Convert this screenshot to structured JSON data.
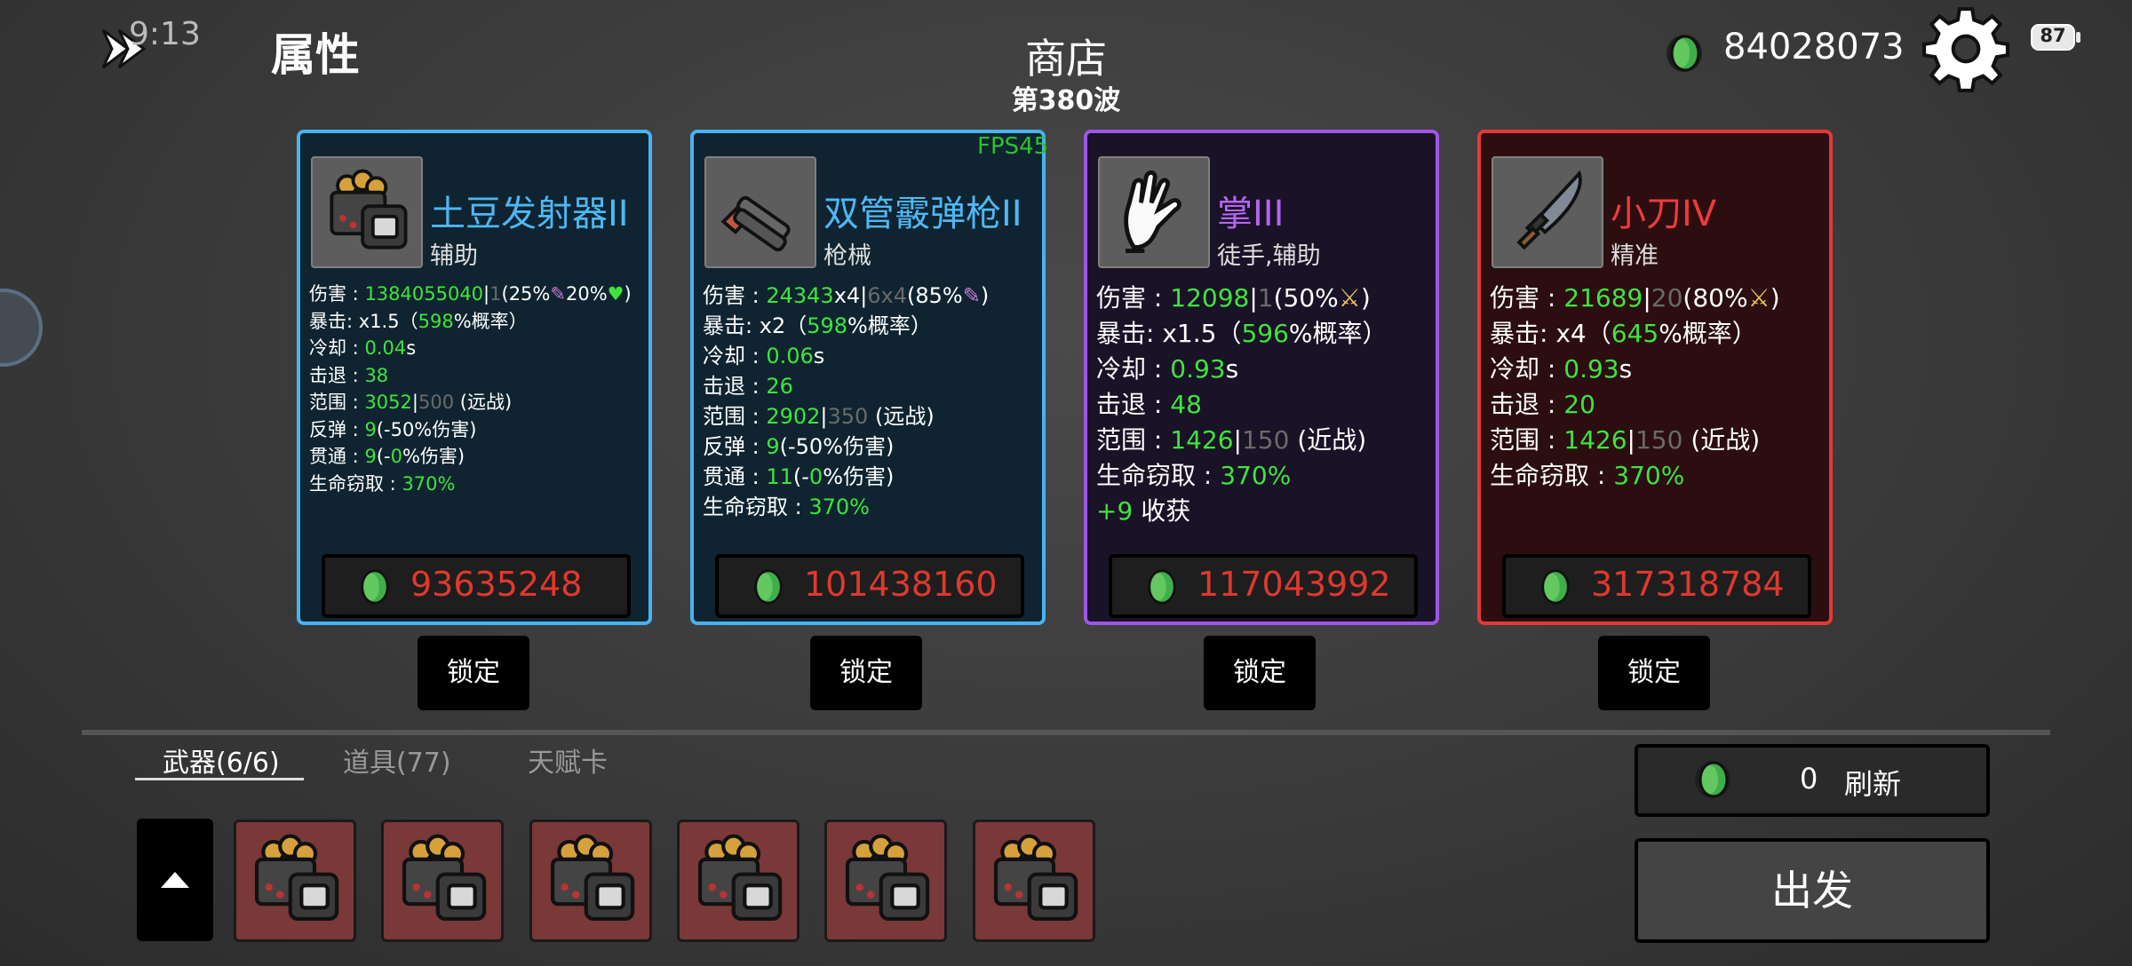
{
  "header": {
    "time": "9:13",
    "attributes_title": "属性",
    "shop_title": "商店",
    "wave": "第380波",
    "money": "84028073",
    "battery": "87",
    "fps": "FPS45"
  },
  "cards": [
    {
      "name": "土豆发射器II",
      "name_color": "#4db8f5",
      "type": "辅助",
      "rarity_color": "#46b4f0",
      "icon": "potato-launcher-icon",
      "damage": "1384055040",
      "damage_base": "1",
      "damage_extra": "(25%",
      "damage_extra2": "20%",
      "damage_tail": ")",
      "crit_mult": "x1.5",
      "crit_chance": "598",
      "crit_suffix": "%概率）",
      "cooldown": "0.04",
      "cooldown_unit": "s",
      "knockback": "38",
      "range": "3052",
      "range_base": "500",
      "range_type": "(远战)",
      "bounce": "9",
      "bounce_note": "(-50%伤害)",
      "pierce": "9",
      "pierce_note_a": "(-",
      "pierce_value": "0",
      "pierce_note_b": "%伤害)",
      "lifesteal": "370%",
      "price": "93635248"
    },
    {
      "name": "双管霰弹枪II",
      "name_color": "#4db8f5",
      "type": "枪械",
      "rarity_color": "#46b4f0",
      "icon": "double-barrel-shotgun-icon",
      "damage": "24343",
      "damage_mult": "x4",
      "damage_base": "6x4",
      "damage_extra": "(85%",
      "damage_tail": ")",
      "crit_mult": "x2",
      "crit_chance": "598",
      "crit_suffix": "%概率）",
      "cooldown": "0.06",
      "cooldown_unit": "s",
      "knockback": "26",
      "range": "2902",
      "range_base": "350",
      "range_type": "(远战)",
      "bounce": "9",
      "bounce_note": "(-50%伤害)",
      "pierce": "11",
      "pierce_note_a": "(-",
      "pierce_value": "0",
      "pierce_note_b": "%伤害)",
      "lifesteal": "370%",
      "price": "101438160"
    },
    {
      "name": "掌III",
      "name_color": "#b565f2",
      "type": "徒手,辅助",
      "rarity_color": "#9f55e8",
      "icon": "palm-hand-icon",
      "damage": "12098",
      "damage_base": "1",
      "damage_extra": "(50%",
      "damage_tail": ")",
      "crit_mult": "x1.5",
      "crit_chance": "596",
      "crit_suffix": "%概率）",
      "cooldown": "0.93",
      "cooldown_unit": "s",
      "knockback": "48",
      "range": "1426",
      "range_base": "150",
      "range_type": "(近战)",
      "lifesteal": "370%",
      "harvest_value": "+9",
      "harvest_label": "收获",
      "price": "117043992"
    },
    {
      "name": "小刀IV",
      "name_color": "#ef3b3b",
      "type": "精准",
      "rarity_color": "#e43838",
      "icon": "knife-icon",
      "damage": "21689",
      "damage_base": "20",
      "damage_extra": "(80%",
      "damage_tail": ")",
      "crit_mult": "x4",
      "crit_chance": "645",
      "crit_suffix": "%概率）",
      "cooldown": "0.93",
      "cooldown_unit": "s",
      "knockback": "20",
      "range": "1426",
      "range_base": "150",
      "range_type": "(近战)",
      "lifesteal": "370%",
      "price": "317318784"
    }
  ],
  "labels": {
    "damage": "伤害 : ",
    "crit": "暴击:",
    "crit_open": "（",
    "cooldown": "冷却 : ",
    "knockback": "击退 : ",
    "range": "范围 : ",
    "bounce": "反弹 : ",
    "pierce": "贯通 : ",
    "lifesteal": "生命窃取 : ",
    "lock": "锁定"
  },
  "tabs": [
    {
      "label": "武器(6/6)",
      "active": true
    },
    {
      "label": "道具(77)",
      "active": false
    },
    {
      "label": "天赋卡",
      "active": false
    }
  ],
  "inventory": {
    "slots": [
      "potato-launcher-icon",
      "potato-launcher-icon",
      "potato-launcher-icon",
      "potato-launcher-icon",
      "potato-launcher-icon",
      "potato-launcher-icon"
    ]
  },
  "refresh": {
    "count": "0",
    "label": "刷新"
  },
  "depart_label": "出发",
  "colors": {
    "stat_green": "#3de53d",
    "price_red": "#e0382e",
    "dim": "#6a6a6a"
  }
}
